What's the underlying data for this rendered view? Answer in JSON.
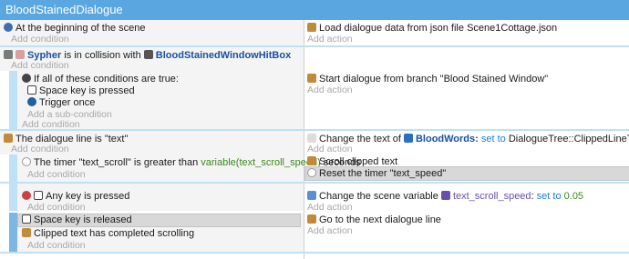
{
  "title": "BloodStainedDialogue",
  "add_condition": "Add condition",
  "add_action": "Add action",
  "add_subcondition": "Add a sub-condition",
  "colors": {
    "header": "#5aa6e0",
    "separator": "#bfe0f7",
    "object": "#1a4fa0",
    "keyword": "#1e7fd6",
    "variable": "#3a8a1a"
  },
  "events": [
    {
      "cond": "At the beginning of the scene",
      "act": {
        "pre": "Load dialogue data from json file",
        "val": "Scene1Cottage.json"
      }
    },
    {
      "cond": {
        "obj1": "Sypher",
        "mid": "is in collision with",
        "obj2": "BloodStainedWindowHitBox"
      },
      "act": {
        "text": "Start dialogue from branch \"Blood Stained Window\""
      },
      "sub": {
        "title": "If all of these conditions are true:",
        "key": "Space",
        "key_suffix": "key is pressed",
        "trigger": "Trigger once"
      }
    },
    {
      "cond": "The dialogue line is \"text\"",
      "act": {
        "pre": "Change the text of",
        "obj": "BloodWords",
        "setto": "set to",
        "val": "DialogueTree::ClippedLineText()"
      }
    },
    {
      "cond": {
        "pre": "The timer \"text_scroll\" is greater than",
        "var": "variable(text_scroll_speed)",
        "post": "seconds"
      },
      "acts": [
        "Scroll clipped text",
        "Reset the timer \"text_speed\""
      ]
    },
    {
      "cond": "Any key is pressed",
      "act": {
        "pre": "Change the scene variable",
        "var": "text_scroll_speed",
        "setto": "set to",
        "num": "0.05"
      }
    },
    {
      "conds": [
        {
          "key": "Space",
          "suffix": "key is released"
        },
        "Clipped text has completed scrolling"
      ],
      "act": "Go to the next dialogue line"
    }
  ]
}
